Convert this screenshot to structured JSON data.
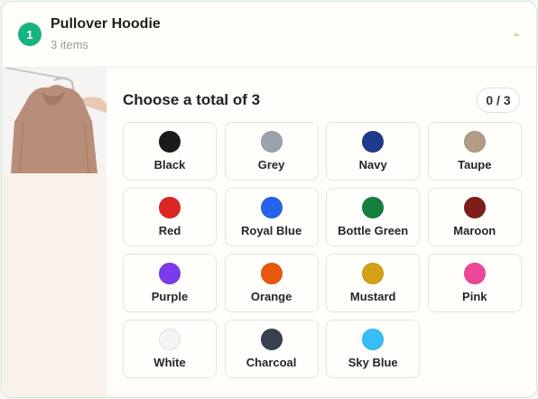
{
  "header": {
    "step_number": "1",
    "title": "Pullover Hoodie",
    "item_count": "3 items",
    "collapse_icon": "chevron-up-icon"
  },
  "product": {
    "image_alt": "hoodie-on-hanger"
  },
  "selection": {
    "title": "Choose a total of 3",
    "counter": "0 / 3"
  },
  "colors": [
    {
      "label": "Black",
      "hex": "#1a1a1a"
    },
    {
      "label": "Grey",
      "hex": "#9ca3af"
    },
    {
      "label": "Navy",
      "hex": "#1e3a8a"
    },
    {
      "label": "Taupe",
      "hex": "#b39c86"
    },
    {
      "label": "Red",
      "hex": "#dc2626"
    },
    {
      "label": "Royal Blue",
      "hex": "#2563eb"
    },
    {
      "label": "Bottle Green",
      "hex": "#15803d"
    },
    {
      "label": "Maroon",
      "hex": "#7f1d1d"
    },
    {
      "label": "Purple",
      "hex": "#7c3aed"
    },
    {
      "label": "Orange",
      "hex": "#ea580c"
    },
    {
      "label": "Mustard",
      "hex": "#d4a017"
    },
    {
      "label": "Pink",
      "hex": "#ec4899"
    },
    {
      "label": "White",
      "hex": "#f3f4f6"
    },
    {
      "label": "Charcoal",
      "hex": "#374151"
    },
    {
      "label": "Sky Blue",
      "hex": "#38bdf8"
    }
  ],
  "accent_color": "#17b381"
}
